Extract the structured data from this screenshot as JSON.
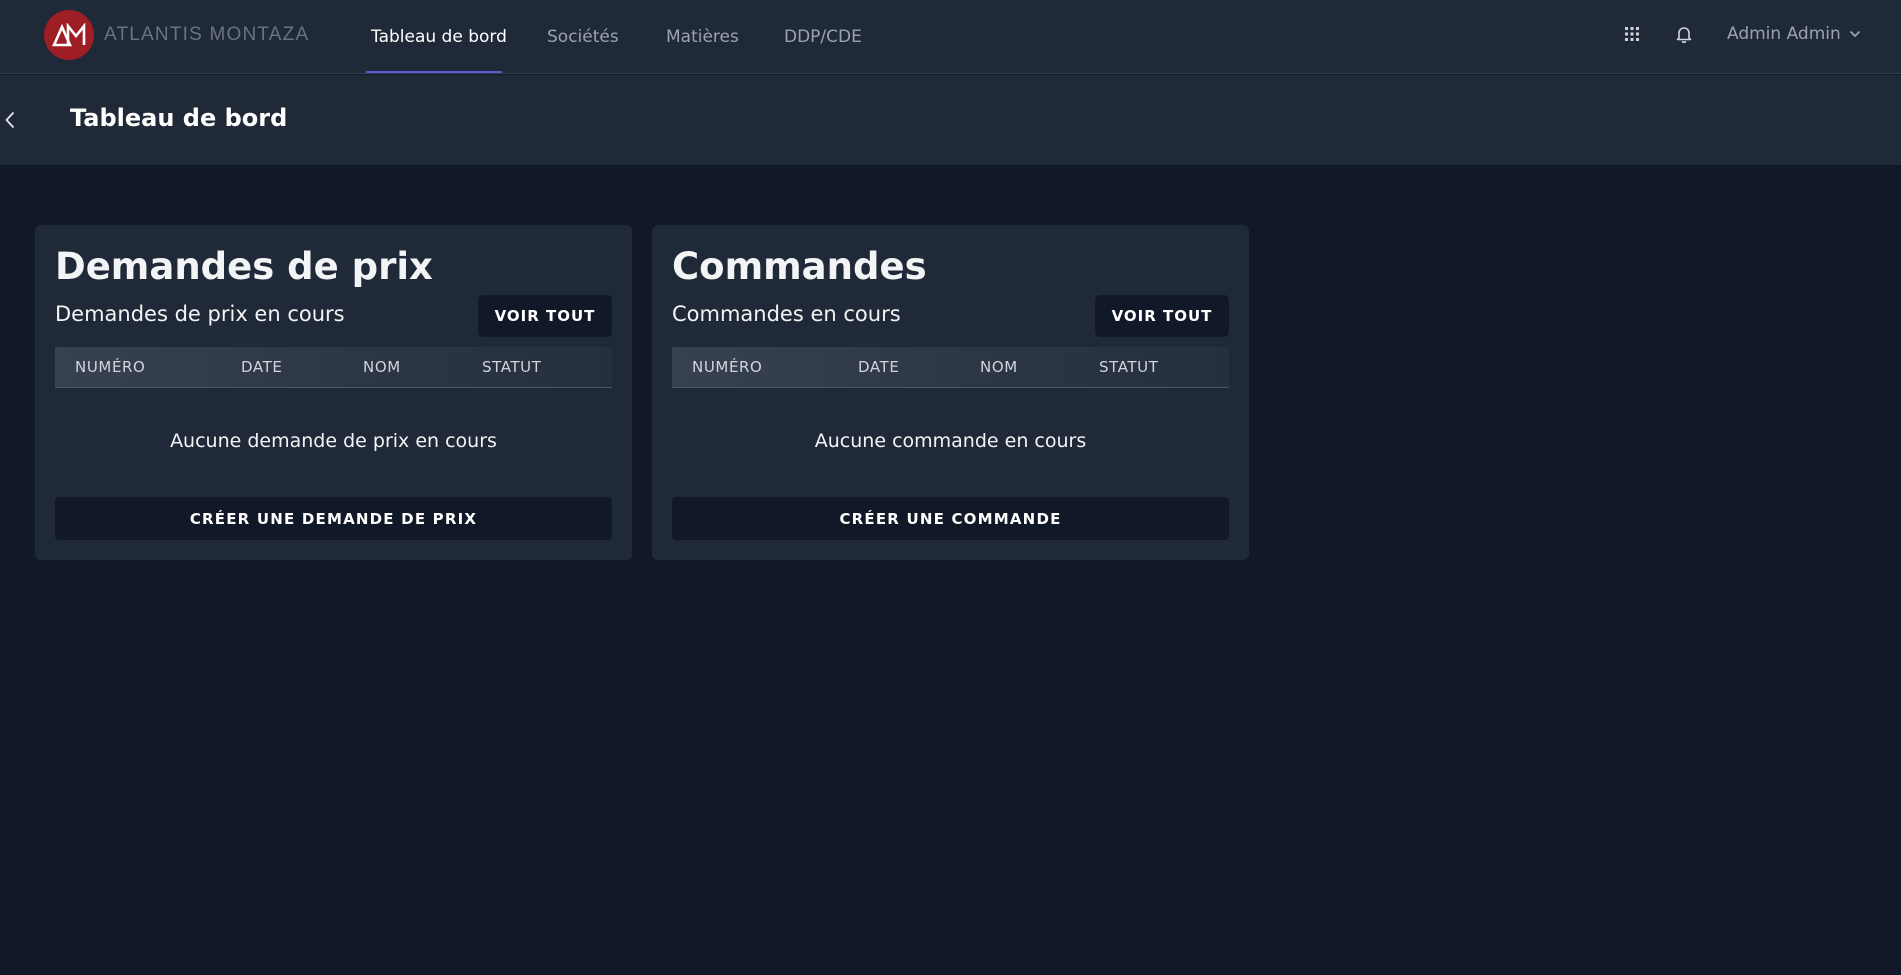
{
  "app": {
    "logo_text": "ATLANTIS MONTAZA",
    "brand_color": "#9f1d24"
  },
  "nav": {
    "tabs": [
      {
        "label": "Tableau de bord",
        "active": true
      },
      {
        "label": "Sociétés",
        "active": false
      },
      {
        "label": "Matières",
        "active": false
      },
      {
        "label": "DDP/CDE",
        "active": false
      }
    ],
    "apps_icon": "grid-icon",
    "notifications_icon": "bell-icon",
    "user_label": "Admin Admin",
    "accent_color": "#5b5bd6"
  },
  "header": {
    "back_icon": "chevron-left-icon",
    "title": "Tableau de bord"
  },
  "cards": {
    "quotes": {
      "title": "Demandes de prix",
      "subtitle": "Demandes de prix en cours",
      "view_all_label": "VOIR TOUT",
      "columns": [
        "NUMÉRO",
        "DATE",
        "NOM",
        "STATUT"
      ],
      "empty_text": "Aucune demande de prix en cours",
      "create_label": "CRÉER UNE DEMANDE DE PRIX"
    },
    "orders": {
      "title": "Commandes",
      "subtitle": "Commandes en cours",
      "view_all_label": "VOIR TOUT",
      "columns": [
        "NUMÉRO",
        "DATE",
        "NOM",
        "STATUT"
      ],
      "empty_text": "Aucune commande en cours",
      "create_label": "CRÉER UNE COMMANDE"
    }
  }
}
